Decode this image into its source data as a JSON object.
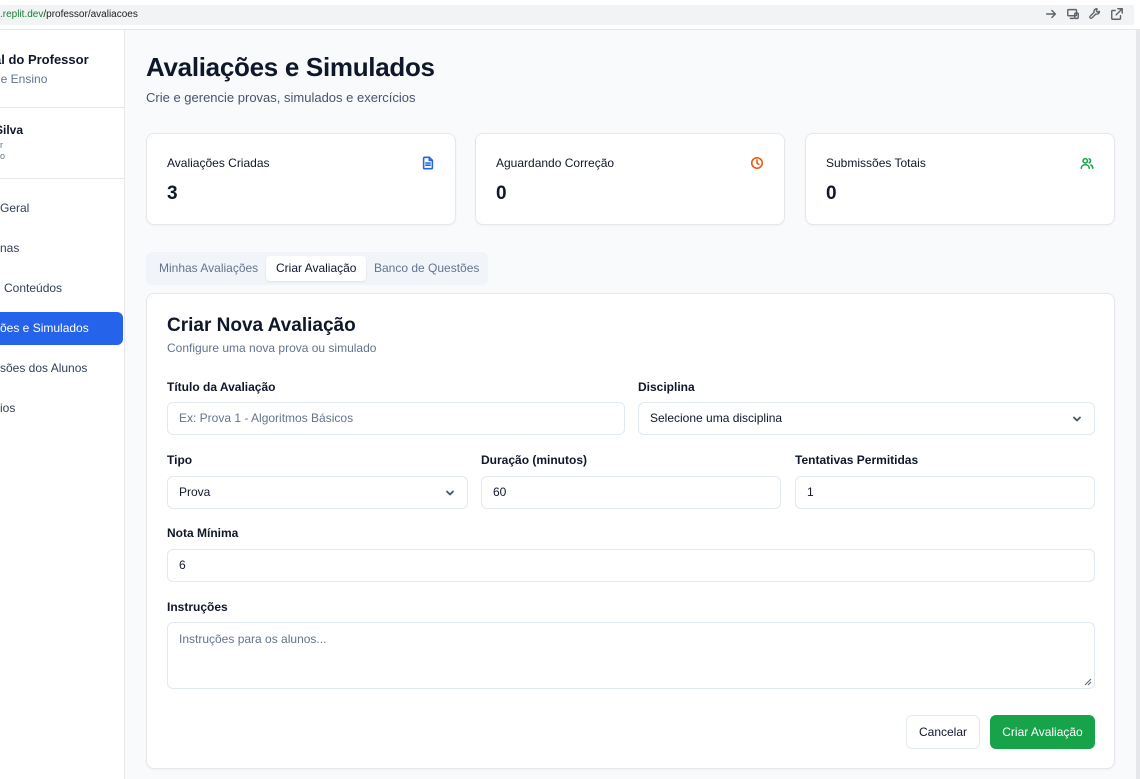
{
  "browser": {
    "url_domain": ".replit.dev",
    "url_path": "/professor/avaliacoes"
  },
  "sidebar": {
    "brand_title": "al do Professor",
    "brand_subtitle": "de Ensino",
    "user_name": "Silva",
    "user_role": "or",
    "user_dept": "ão",
    "items": [
      {
        "label": "Geral",
        "active": false
      },
      {
        "label": "nas",
        "active": false
      },
      {
        "label": "Conteúdos",
        "active": false
      },
      {
        "label": "ões e Simulados",
        "active": true
      },
      {
        "label": "sões dos Alunos",
        "active": false
      },
      {
        "label": "ios",
        "active": false
      }
    ]
  },
  "header": {
    "title": "Avaliações e Simulados",
    "subtitle": "Crie e gerencie provas, simulados e exercícios"
  },
  "stats": [
    {
      "label": "Avaliações Criadas",
      "value": "3",
      "icon": "document-icon",
      "color": "#2563eb"
    },
    {
      "label": "Aguardando Correção",
      "value": "0",
      "icon": "clock-icon",
      "color": "#ea580c"
    },
    {
      "label": "Submissões Totais",
      "value": "0",
      "icon": "users-icon",
      "color": "#16a34a"
    }
  ],
  "tabs": [
    {
      "label": "Minhas Avaliações",
      "active": false
    },
    {
      "label": "Criar Avaliação",
      "active": true
    },
    {
      "label": "Banco de Questões",
      "active": false
    }
  ],
  "form": {
    "title": "Criar Nova Avaliação",
    "subtitle": "Configure uma nova prova ou simulado",
    "titulo_label": "Título da Avaliação",
    "titulo_placeholder": "Ex: Prova 1 - Algoritmos Básicos",
    "disciplina_label": "Disciplina",
    "disciplina_value": "Selecione uma disciplina",
    "tipo_label": "Tipo",
    "tipo_value": "Prova",
    "duracao_label": "Duração (minutos)",
    "duracao_value": "60",
    "tentativas_label": "Tentativas Permitidas",
    "tentativas_value": "1",
    "nota_label": "Nota Mínima",
    "nota_value": "6",
    "instrucoes_label": "Instruções",
    "instrucoes_placeholder": "Instruções para os alunos...",
    "cancel_label": "Cancelar",
    "submit_label": "Criar Avaliação"
  }
}
